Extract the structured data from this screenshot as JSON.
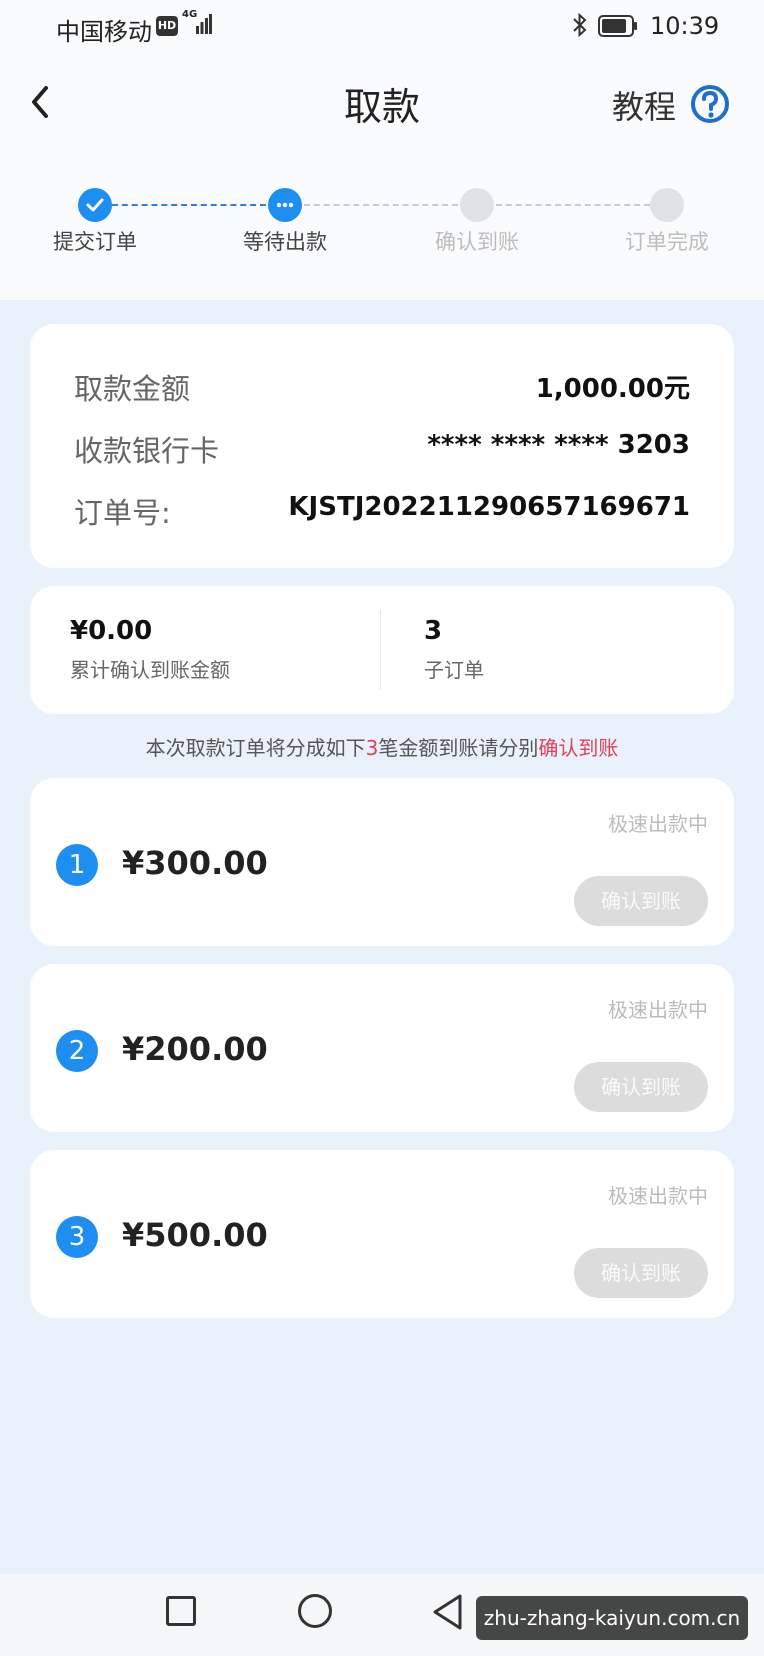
{
  "status_bar": {
    "carrier": "中国移动",
    "hd": "HD",
    "network": "4G",
    "time": "10:39"
  },
  "header": {
    "title": "取款",
    "tutorial": "教程"
  },
  "stepper": [
    {
      "label": "提交订单",
      "state": "done"
    },
    {
      "label": "等待出款",
      "state": "active"
    },
    {
      "label": "确认到账",
      "state": "pending"
    },
    {
      "label": "订单完成",
      "state": "pending"
    }
  ],
  "order_info": {
    "amount_label": "取款金额",
    "amount_value": "1,000.00元",
    "card_label": "收款银行卡",
    "card_value": "**** **** **** 3203",
    "order_no_label": "订单号:",
    "order_no_value": "KJSTJ202211290657169671"
  },
  "summary": {
    "confirmed_amount": "¥0.00",
    "confirmed_label": "累计确认到账金额",
    "sub_count": "3",
    "sub_count_label": "子订单"
  },
  "notice": {
    "prefix": "本次取款订单将分成如下",
    "count": "3",
    "middle": "笔金额到账请分别",
    "highlight": "确认到账"
  },
  "sub_orders": [
    {
      "index": "1",
      "amount": "¥300.00",
      "status": "极速出款中",
      "button": "确认到账"
    },
    {
      "index": "2",
      "amount": "¥200.00",
      "status": "极速出款中",
      "button": "确认到账"
    },
    {
      "index": "3",
      "amount": "¥500.00",
      "status": "极速出款中",
      "button": "确认到账"
    }
  ],
  "watermark": "zhu-zhang-kaiyun.com.cn",
  "colors": {
    "accent": "#1e8ff0",
    "highlight_red": "#e0405a",
    "disabled_button": "#dcdcdc"
  }
}
